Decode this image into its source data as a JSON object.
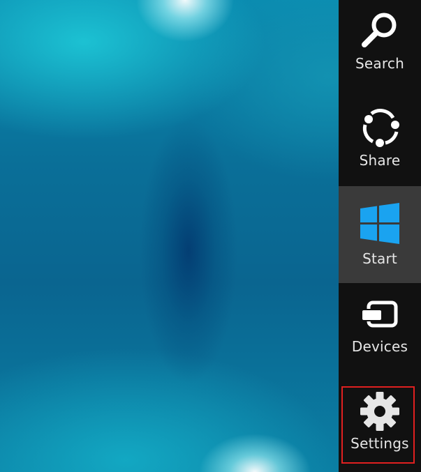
{
  "charms": [
    {
      "id": "search",
      "label": "Search",
      "icon": "search-icon",
      "active": false
    },
    {
      "id": "share",
      "label": "Share",
      "icon": "share-icon",
      "active": false
    },
    {
      "id": "start",
      "label": "Start",
      "icon": "windows-logo-icon",
      "active": true
    },
    {
      "id": "devices",
      "label": "Devices",
      "icon": "devices-icon",
      "active": false
    },
    {
      "id": "settings",
      "label": "Settings",
      "icon": "gear-icon",
      "active": false,
      "highlighted": true
    }
  ],
  "colors": {
    "charms_bar": "#111111",
    "active_charm": "#3a3a3a",
    "icon": "#ffffff",
    "windows_logo": "#1aa3f0",
    "highlight": "#e02020"
  }
}
